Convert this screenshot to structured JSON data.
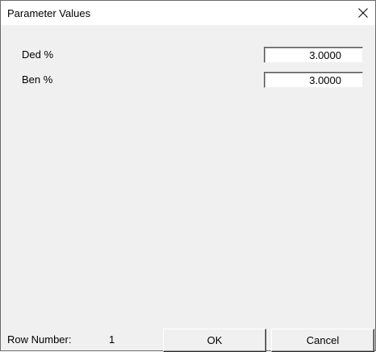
{
  "window": {
    "title": "Parameter Values",
    "close_icon": "close-icon"
  },
  "parameters": [
    {
      "label": "Ded %",
      "value": "3.0000"
    },
    {
      "label": "Ben %",
      "value": "3.0000"
    }
  ],
  "footer": {
    "row_number_label": "Row Number:",
    "row_number_value": "1",
    "ok_label": "OK",
    "cancel_label": "Cancel"
  }
}
